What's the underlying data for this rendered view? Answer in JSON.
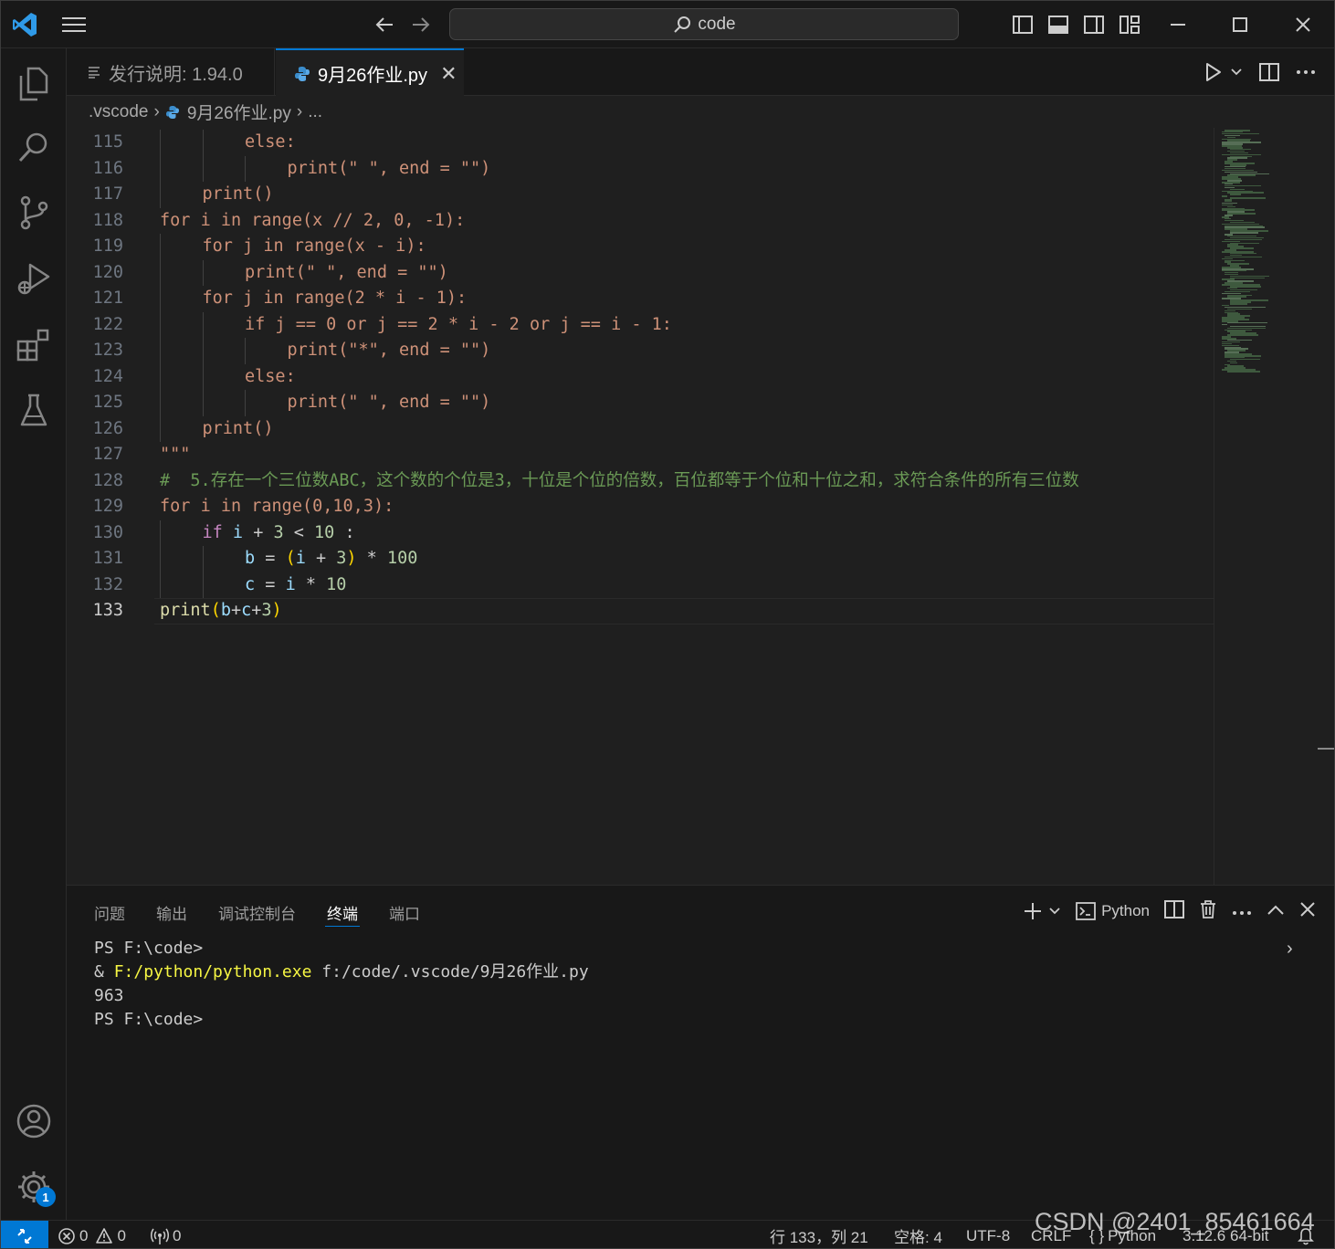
{
  "titlebar": {
    "search_text": "code"
  },
  "tabs": [
    {
      "label": "发行说明: 1.94.0",
      "icon": "preview-lines-icon"
    },
    {
      "label": "9月26作业.py",
      "icon": "python-icon",
      "close": "✕"
    }
  ],
  "breadcrumb": {
    "folder": ".vscode",
    "file": "9月26作业.py",
    "more": "..."
  },
  "editor": {
    "lines": [
      {
        "n": "115",
        "indent": 2,
        "code": "else:"
      },
      {
        "n": "116",
        "indent": 3,
        "code": "print(\" \", end = \"\")"
      },
      {
        "n": "117",
        "indent": 1,
        "code": "print()"
      },
      {
        "n": "118",
        "indent": 0,
        "code": "for i in range(x // 2, 0, -1):"
      },
      {
        "n": "119",
        "indent": 1,
        "code": "for j in range(x - i):"
      },
      {
        "n": "120",
        "indent": 2,
        "code": "print(\" \", end = \"\")"
      },
      {
        "n": "121",
        "indent": 1,
        "code": "for j in range(2 * i - 1):"
      },
      {
        "n": "122",
        "indent": 2,
        "code": "if j == 0 or j == 2 * i - 2 or j == i - 1:"
      },
      {
        "n": "123",
        "indent": 3,
        "code": "print(\"*\", end = \"\")"
      },
      {
        "n": "124",
        "indent": 2,
        "code": "else:"
      },
      {
        "n": "125",
        "indent": 3,
        "code": "print(\" \", end = \"\")"
      },
      {
        "n": "126",
        "indent": 1,
        "code": "print()"
      },
      {
        "n": "127",
        "indent": 0,
        "code": "\"\"\""
      },
      {
        "n": "128",
        "indent": 0,
        "code": "#  5.存在一个三位数ABC，这个数的个位是3，十位是个位的倍数，百位都等于个位和十位之和，求符合条件的所有三位数"
      },
      {
        "n": "129",
        "indent": 0,
        "code": "for i in range(0,10,3):"
      },
      {
        "n": "130",
        "indent": 1,
        "code": "if i + 3 < 10 :"
      },
      {
        "n": "131",
        "indent": 2,
        "code": "b = (i + 3) * 100"
      },
      {
        "n": "132",
        "indent": 2,
        "code": "c = i * 10"
      },
      {
        "n": "133",
        "indent": 0,
        "code": "print(b+c+3)"
      }
    ],
    "active_line": "133"
  },
  "panel": {
    "tabs": [
      "问题",
      "输出",
      "调试控制台",
      "终端",
      "端口"
    ],
    "active_tab": "终端",
    "terminal_profile": "Python",
    "terminal": {
      "line1": "PS F:\\code>",
      "line2_prefix": "& ",
      "line2_exe": "F:/python/python.exe",
      "line2_arg": " f:/code/.vscode/9月26作业.py",
      "line3": "963",
      "line4": "PS F:\\code>"
    }
  },
  "statusbar": {
    "errors": "0",
    "warnings": "0",
    "ports": "0",
    "position": "行 133，列 21",
    "spaces": "空格: 4",
    "encoding": "UTF-8",
    "eol": "CRLF",
    "language": "Python",
    "interpreter": "3.12.6 64-bit"
  },
  "settings_badge": "1",
  "watermark": "CSDN @2401_85461664"
}
